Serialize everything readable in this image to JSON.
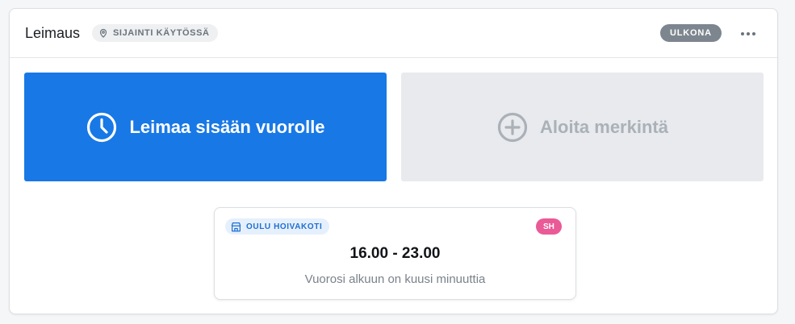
{
  "header": {
    "title": "Leimaus",
    "location_chip": {
      "label": "SIJAINTI KÄYTÖSSÄ",
      "icon": "map-pin-icon"
    },
    "status": "ULKONA",
    "more_icon": "ellipsis-icon"
  },
  "actions": {
    "clock_in": {
      "label": "Leimaa sisään vuorolle",
      "icon": "clock-icon",
      "color": "#1878e6"
    },
    "start_entry": {
      "label": "Aloita merkintä",
      "icon": "plus-circle-icon",
      "disabled": true
    }
  },
  "shift": {
    "unit": {
      "label": "OULU HOIVAKOTI",
      "icon": "building-icon"
    },
    "initials": "SH",
    "time": "16.00 - 23.00",
    "note": "Vuorosi alkuun on kuusi minuuttia"
  },
  "colors": {
    "primary": "#1878e6",
    "status_gray": "#7d868f",
    "initials_pink": "#ea5a96",
    "unit_chip_text": "#1f6fd1"
  }
}
